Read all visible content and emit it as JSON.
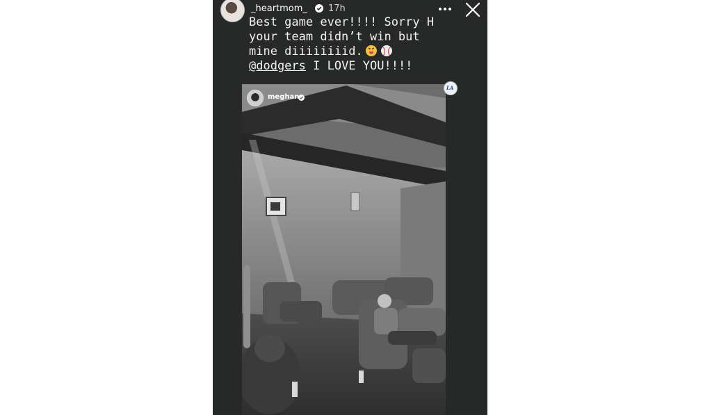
{
  "story": {
    "username": "_heartmom_",
    "time": "17h",
    "caption_lines": [
      "Best game ever!!!! Sorry H",
      "your team didn’t win but",
      "mine diiiiiiiid."
    ],
    "mention": "@dodgers",
    "caption_end": " I LOVE YOU!!!!",
    "icons": {
      "verified": "verified-badge-icon",
      "more": "more-options-icon",
      "close": "close-icon",
      "emoji1": "squinting-tongue-emoji",
      "emoji2": "baseball-emoji"
    }
  },
  "repost": {
    "username": "meghan",
    "logo": "dodgers-logo"
  },
  "colors": {
    "story_background": "#272828",
    "text": "#ffffff",
    "verified_blue": "#3897f0"
  }
}
